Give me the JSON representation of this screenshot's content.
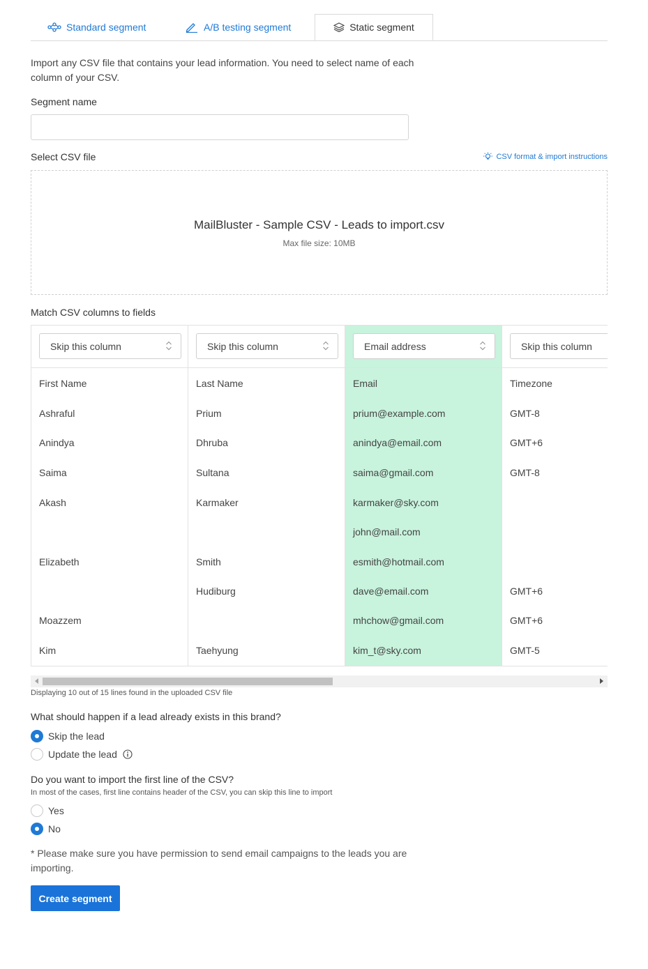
{
  "tabs": [
    {
      "label": "Standard segment",
      "icon": "hierarchy-icon"
    },
    {
      "label": "A/B testing segment",
      "icon": "pen-icon"
    },
    {
      "label": "Static segment",
      "icon": "layers-icon",
      "active": true
    }
  ],
  "intro": "Import any CSV file that contains your lead information. You need to select name of each column of your CSV.",
  "segment_name": {
    "label": "Segment name",
    "value": "",
    "placeholder": ""
  },
  "csv": {
    "label": "Select CSV file",
    "help_link": "CSV format & import instructions",
    "file_name": "MailBluster - Sample CSV - Leads to import.csv",
    "max_size": "Max file size: 10MB"
  },
  "match": {
    "label": "Match CSV columns to fields",
    "columns": [
      {
        "field": "Skip this column",
        "cells": [
          "First Name",
          "Ashraful",
          "Anindya",
          "Saima",
          "Akash",
          "",
          "Elizabeth",
          "",
          "Moazzem",
          "Kim"
        ]
      },
      {
        "field": "Skip this column",
        "cells": [
          "Last Name",
          "Prium",
          "Dhruba",
          "Sultana",
          "Karmaker",
          "",
          "Smith",
          "Hudiburg",
          "",
          "Taehyung"
        ]
      },
      {
        "field": "Email address",
        "matched": true,
        "cells": [
          "Email",
          "prium@example.com",
          "anindya@email.com",
          "saima@gmail.com",
          "karmaker@sky.com",
          "john@mail.com",
          "esmith@hotmail.com",
          "dave@email.com",
          "mhchow@gmail.com",
          "kim_t@sky.com"
        ]
      },
      {
        "field": "Skip this column",
        "cells": [
          "Timezone",
          "GMT-8",
          "GMT+6",
          "GMT-8",
          "",
          "",
          "",
          "GMT+6",
          "GMT+6",
          "GMT-5"
        ]
      }
    ],
    "display_note": "Displaying 10 out of 15 lines found in the uploaded CSV file"
  },
  "existing_lead": {
    "question": "What should happen if a lead already exists in this brand?",
    "options": [
      {
        "label": "Skip the lead",
        "selected": true
      },
      {
        "label": "Update the lead",
        "selected": false
      }
    ]
  },
  "first_line": {
    "question": "Do you want to import the first line of the CSV?",
    "hint": "In most of the cases, first line contains header of the CSV, you can skip this line to import",
    "options": [
      {
        "label": "Yes",
        "selected": false
      },
      {
        "label": "No",
        "selected": true
      }
    ]
  },
  "disclaimer": "* Please make sure you have permission to send email campaigns to the leads you are importing.",
  "submit_label": "Create segment",
  "colors": {
    "accent": "#1f7ad6",
    "matched_column": "#c8f3dd",
    "button": "#1a73d9"
  }
}
